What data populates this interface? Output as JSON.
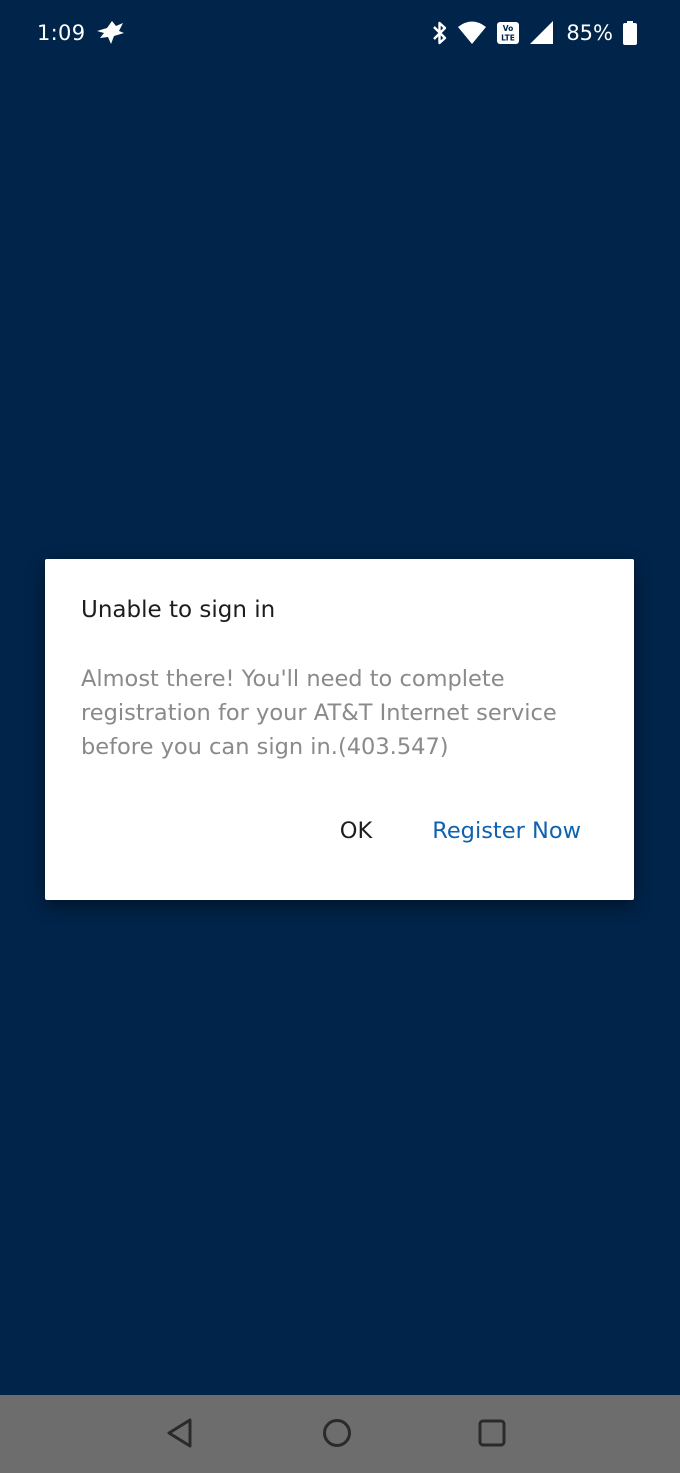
{
  "status_bar": {
    "time": "1:09",
    "battery_percent": "85%",
    "icons": [
      "app-notification-icon",
      "bluetooth-icon",
      "wifi-icon",
      "volte-icon",
      "cellular-signal-icon",
      "battery-icon"
    ],
    "network_badge": "Vo LTE"
  },
  "dialog": {
    "title": "Unable to sign in",
    "message": "Almost there! You'll need to complete registration for your AT&T Internet service before you can sign in.(403.547)",
    "ok_label": "OK",
    "register_label": "Register Now"
  },
  "navigation_bar": {
    "buttons": [
      "back-icon",
      "home-icon",
      "recents-icon"
    ]
  },
  "colors": {
    "background": "#00244a",
    "dialog_background": "#ffffff",
    "accent": "#0e62b0",
    "title_text": "#1d1d1d",
    "message_text": "#8a8a8a",
    "nav_bar": "#6d6d6d"
  }
}
